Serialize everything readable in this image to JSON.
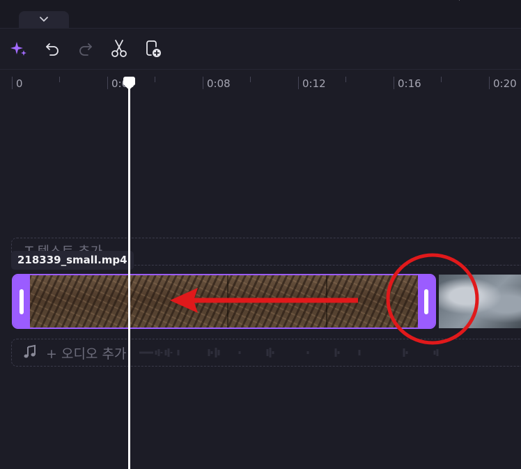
{
  "ruler": {
    "labels": [
      "0",
      "0:04",
      "0:08",
      "0:12",
      "0:16",
      "0:20"
    ]
  },
  "tracks": {
    "text_track_label": "T   텍스트 추가",
    "clip_tooltip": "218339_small.mp4",
    "audio_track_label": "+ 오디오 추가"
  },
  "colors": {
    "accent": "#9b5cff",
    "annotation": "#e0191b",
    "background": "#1c1c26"
  },
  "icons": {
    "collapse": "chevron-down-icon",
    "ai": "sparkle-icon",
    "undo": "undo-icon",
    "redo": "redo-icon",
    "split": "scissors-icon",
    "add_clip": "add-to-timeline-icon",
    "music": "music-note-icon"
  }
}
